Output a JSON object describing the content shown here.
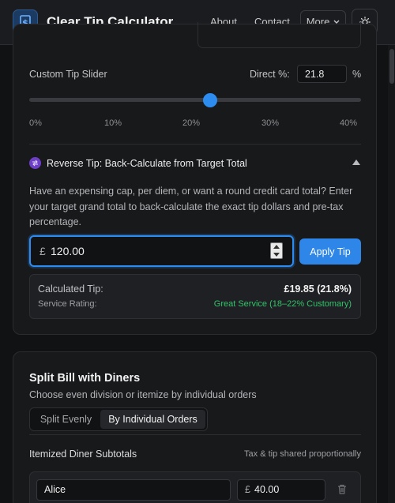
{
  "header": {
    "title": "Clear Tip Calculator",
    "logo_icon": "dollar-receipt-icon",
    "nav": {
      "about": "About",
      "contact": "Contact",
      "more": "More"
    },
    "theme_icon": "sun-icon"
  },
  "tip_card": {
    "slider_label": "Custom Tip Slider",
    "direct_label": "Direct %:",
    "direct_value": "21.8",
    "pct_unit": "%",
    "slider_value_percent": 21.8,
    "slider_range": [
      0,
      40
    ],
    "ticks": [
      "0%",
      "10%",
      "20%",
      "30%",
      "40%"
    ]
  },
  "reverse_tip": {
    "icon": "swap-arrows-icon",
    "title": "Reverse Tip: Back-Calculate from Target Total",
    "description": "Have an expensing cap, per diem, or want a round credit card total? Enter your target grand total to back-calculate the exact tip dollars and pre-tax percentage.",
    "currency": "£",
    "amount": "120.00",
    "apply_label": "Apply Tip",
    "calc_label": "Calculated Tip:",
    "calc_value": "£19.85 (21.8%)",
    "service_label": "Service Rating:",
    "service_value": "Great Service (18–22% Customary)",
    "accent_color": "#2d8cf0",
    "success_color": "#33c26b"
  },
  "split": {
    "title": "Split Bill with Diners",
    "subtitle": "Choose even division or itemize by individual orders",
    "tab_evenly": "Split Evenly",
    "tab_orders": "By Individual Orders",
    "heading": "Itemized Diner Subtotals",
    "note": "Tax & tip shared proportionally",
    "diners": [
      {
        "name": "Alice",
        "currency": "£",
        "amount": "40.00"
      }
    ]
  }
}
